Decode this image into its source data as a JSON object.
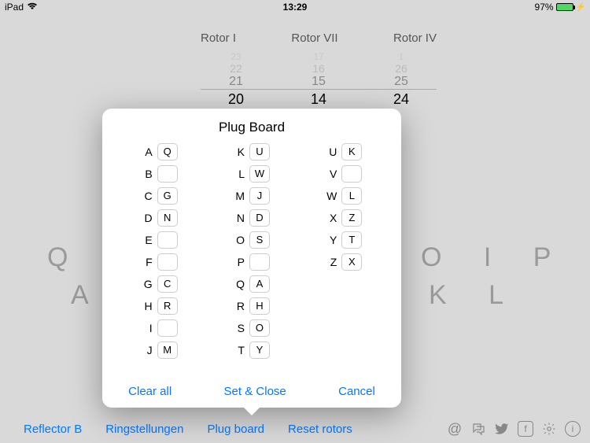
{
  "statusBar": {
    "device": "iPad",
    "time": "13:29",
    "battery": "97%"
  },
  "rotors": {
    "labels": [
      "Rotor I",
      "Rotor VII",
      "Rotor IV"
    ],
    "rows": [
      [
        "23",
        "17",
        "1"
      ],
      [
        "22",
        "16",
        "26"
      ],
      [
        "21",
        "15",
        "25"
      ],
      [
        "20",
        "14",
        "24"
      ]
    ]
  },
  "keyboardBack": {
    "row1": "Q",
    "row1b": "O I P",
    "row2": "A",
    "row2b": "K  L"
  },
  "toolbar": {
    "links": [
      "Reflector B",
      "Ringstellungen",
      "Plug board",
      "Reset rotors"
    ],
    "icons": [
      "at-icon",
      "chat-icon",
      "twitter-icon",
      "facebook-icon",
      "gear-icon",
      "info-icon"
    ]
  },
  "popover": {
    "title": "Plug Board",
    "actions": {
      "clear": "Clear all",
      "set": "Set & Close",
      "cancel": "Cancel"
    },
    "cols": [
      [
        [
          "A",
          "Q"
        ],
        [
          "B",
          ""
        ],
        [
          "C",
          "G"
        ],
        [
          "D",
          "N"
        ],
        [
          "E",
          ""
        ],
        [
          "F",
          ""
        ],
        [
          "G",
          "C"
        ],
        [
          "H",
          "R"
        ],
        [
          "I",
          ""
        ],
        [
          "J",
          "M"
        ]
      ],
      [
        [
          "K",
          "U"
        ],
        [
          "L",
          "W"
        ],
        [
          "M",
          "J"
        ],
        [
          "N",
          "D"
        ],
        [
          "O",
          "S"
        ],
        [
          "P",
          ""
        ],
        [
          "Q",
          "A"
        ],
        [
          "R",
          "H"
        ],
        [
          "S",
          "O"
        ],
        [
          "T",
          "Y"
        ]
      ],
      [
        [
          "U",
          "K"
        ],
        [
          "V",
          ""
        ],
        [
          "W",
          "L"
        ],
        [
          "X",
          "Z"
        ],
        [
          "Y",
          "T"
        ],
        [
          "Z",
          "X"
        ]
      ]
    ]
  }
}
